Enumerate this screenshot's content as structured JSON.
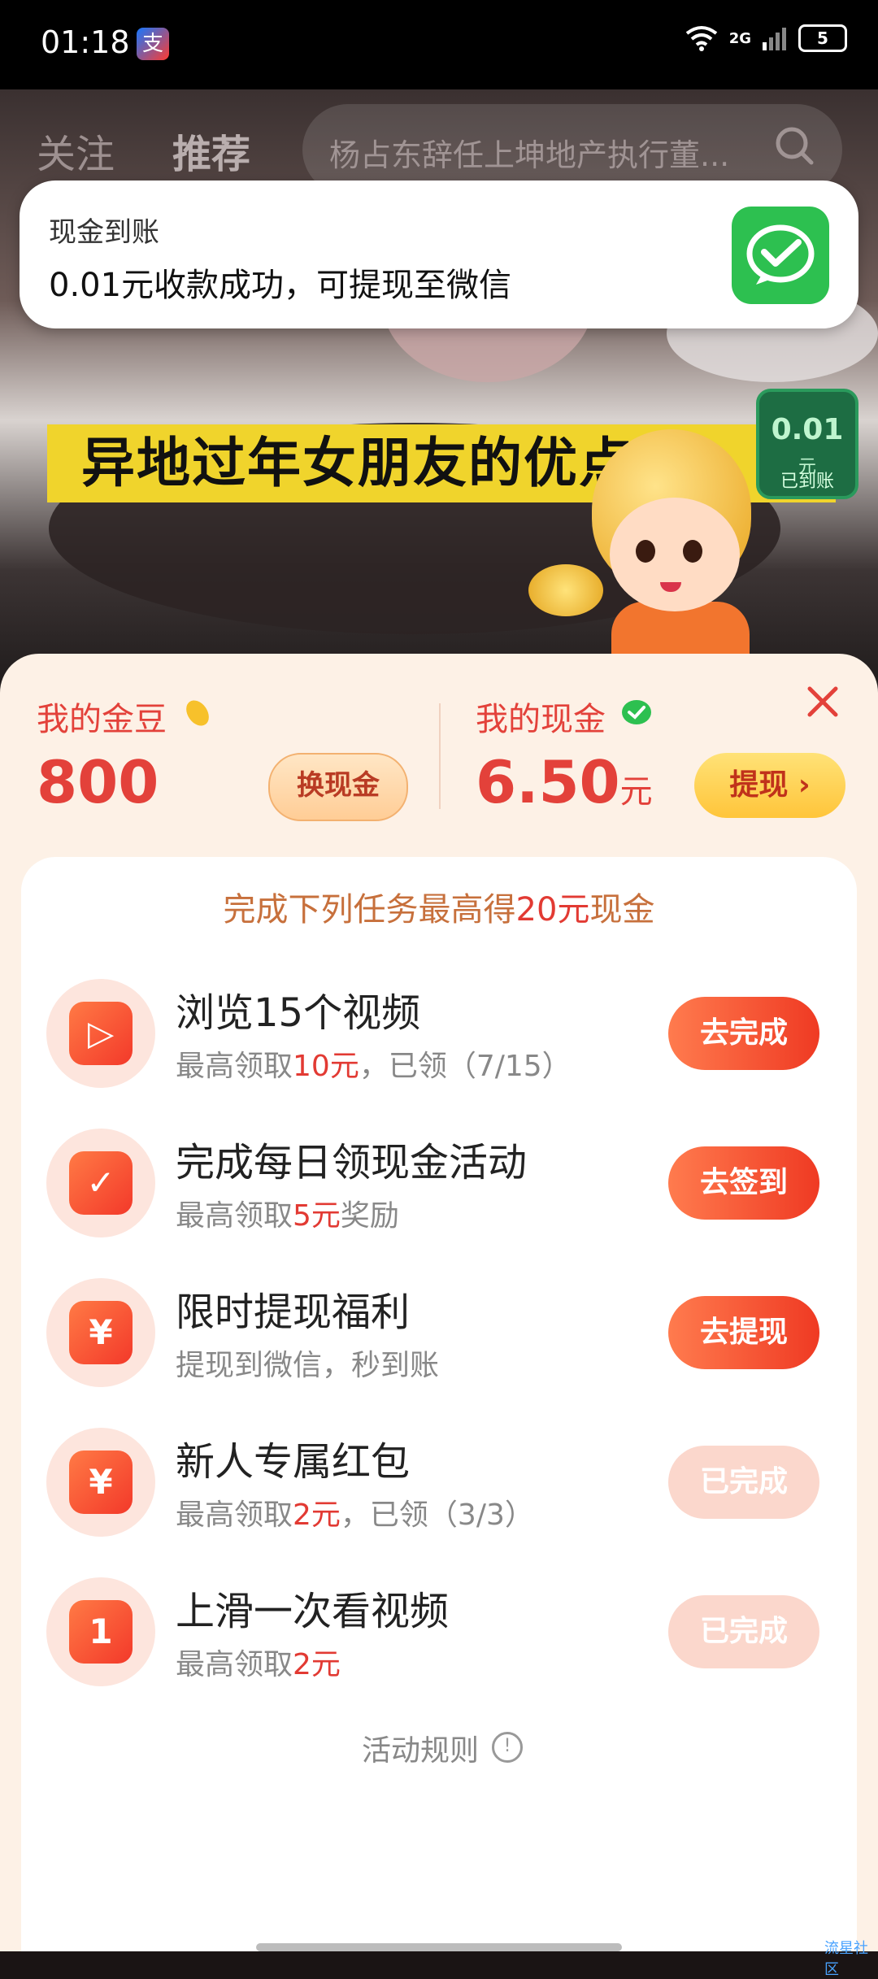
{
  "status_bar": {
    "time": "01:18",
    "app_icon_label": "支",
    "network": "2G",
    "battery": "5"
  },
  "video": {
    "tabs": [
      "关注",
      "推荐"
    ],
    "search_placeholder": "杨占东辞任上坤地产执行董...",
    "banner_text": "异地过年女朋友的优点",
    "mini_cash": {
      "value": "0.01",
      "unit": "元",
      "label": "已到账"
    }
  },
  "notification": {
    "title": "现金到账",
    "body": "0.01元收款成功，可提现至微信"
  },
  "wallet": {
    "gold_label": "我的金豆",
    "gold_value": "800",
    "exchange_label": "换现金",
    "cash_label": "我的现金",
    "cash_value": "6.50",
    "cash_unit": "元",
    "withdraw_label": "提现 ›"
  },
  "tasks_header": {
    "prefix": "完成下列任务最高得",
    "highlight": "20元",
    "suffix": "现金"
  },
  "tasks": [
    {
      "title": "浏览15个视频",
      "sub_prefix": "最高领取",
      "sub_highlight": "10元",
      "sub_suffix": "，已领（7/15）",
      "button": "去完成",
      "state": "active",
      "icon": "play-icon",
      "icon_glyph": "▷"
    },
    {
      "title": "完成每日领现金活动",
      "sub_prefix": "最高领取",
      "sub_highlight": "5元",
      "sub_suffix": "奖励",
      "button": "去签到",
      "state": "active",
      "icon": "check-icon",
      "icon_glyph": "✓"
    },
    {
      "title": "限时提现福利",
      "sub_prefix": "提现到微信，秒到账",
      "sub_highlight": "",
      "sub_suffix": "",
      "button": "去提现",
      "state": "active",
      "icon": "yuan-icon",
      "icon_glyph": "¥"
    },
    {
      "title": "新人专属红包",
      "sub_prefix": "最高领取",
      "sub_highlight": "2元",
      "sub_suffix": "，已领（3/3）",
      "button": "已完成",
      "state": "done",
      "icon": "red-envelope-icon",
      "icon_glyph": "¥"
    },
    {
      "title": "上滑一次看视频",
      "sub_prefix": "最高领取",
      "sub_highlight": "2元",
      "sub_suffix": "",
      "button": "已完成",
      "state": "done",
      "icon": "tv-icon",
      "icon_glyph": "1"
    }
  ],
  "rules_label": "活动规则",
  "watermark": "流星社区",
  "colors": {
    "accent": "#e3413a",
    "wechat": "#2dc050",
    "sheet_bg": "#fdf1e6"
  }
}
